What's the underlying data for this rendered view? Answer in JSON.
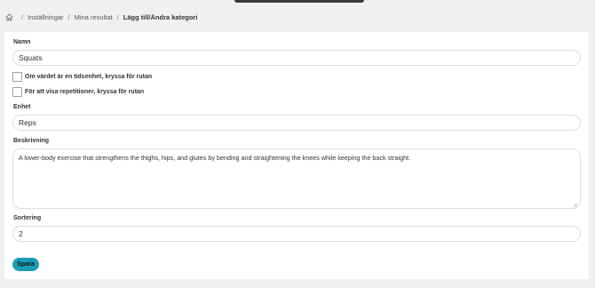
{
  "breadcrumb": {
    "home_icon": "home-icon",
    "separator": "/",
    "items": [
      "Inställningar",
      "Mina resultat"
    ],
    "current": "Lägg till/Ändra kategori"
  },
  "form": {
    "name_label": "Namn",
    "name_value": "Squats",
    "checkbox_time_label": "Om värdet är en tidsenhet, kryssa för rutan",
    "checkbox_time_checked": false,
    "checkbox_reps_label": "För att visa repetitioner, kryssa för rutan",
    "checkbox_reps_checked": false,
    "unit_label": "Enhet",
    "unit_value": "Reps",
    "description_label": "Beskrivning",
    "description_value": "A lower-body exercise that strengthens the thighs, hips, and glutes by bending and straightening the knees while keeping the back straight.",
    "sort_label": "Sortering",
    "sort_value": "2",
    "save_label": "Spara"
  },
  "colors": {
    "accent": "#1a9cb8",
    "background": "#eef0f2",
    "card": "#ffffff"
  }
}
